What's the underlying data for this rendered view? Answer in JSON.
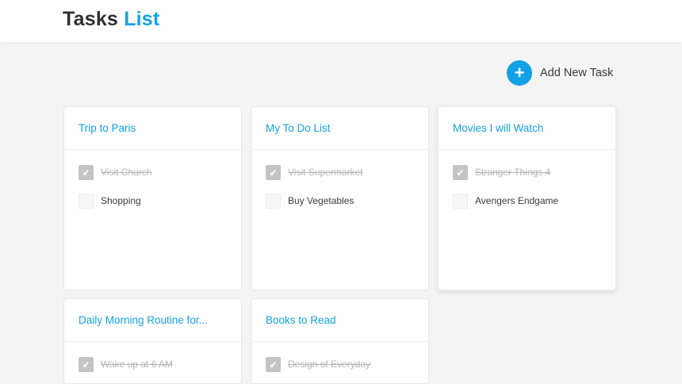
{
  "header": {
    "title_part1": "Tasks",
    "title_part2": "List"
  },
  "add_task": {
    "icon_glyph": "+",
    "label": "Add New Task"
  },
  "colors": {
    "accent": "#13a1e6",
    "background": "#f4f4f5",
    "checked_box": "#c4c4c4"
  },
  "lists": [
    {
      "title": "Trip to Paris",
      "tasks": [
        {
          "label": "Visit Church",
          "done": true
        },
        {
          "label": "Shopping",
          "done": false
        }
      ]
    },
    {
      "title": "My To Do List",
      "tasks": [
        {
          "label": "Visit Supermarket",
          "done": true
        },
        {
          "label": "Buy Vegetables",
          "done": false
        }
      ]
    },
    {
      "title": "Movies I will Watch",
      "tasks": [
        {
          "label": "Stranger Things 4",
          "done": true
        },
        {
          "label": "Avengers Endgame",
          "done": false
        }
      ]
    },
    {
      "title": "Daily Morning Routine for...",
      "tasks": [
        {
          "label": "Wake up at 6 AM",
          "done": true
        }
      ]
    },
    {
      "title": "Books to Read",
      "tasks": [
        {
          "label": "Design of Everyday",
          "done": true
        }
      ]
    }
  ]
}
